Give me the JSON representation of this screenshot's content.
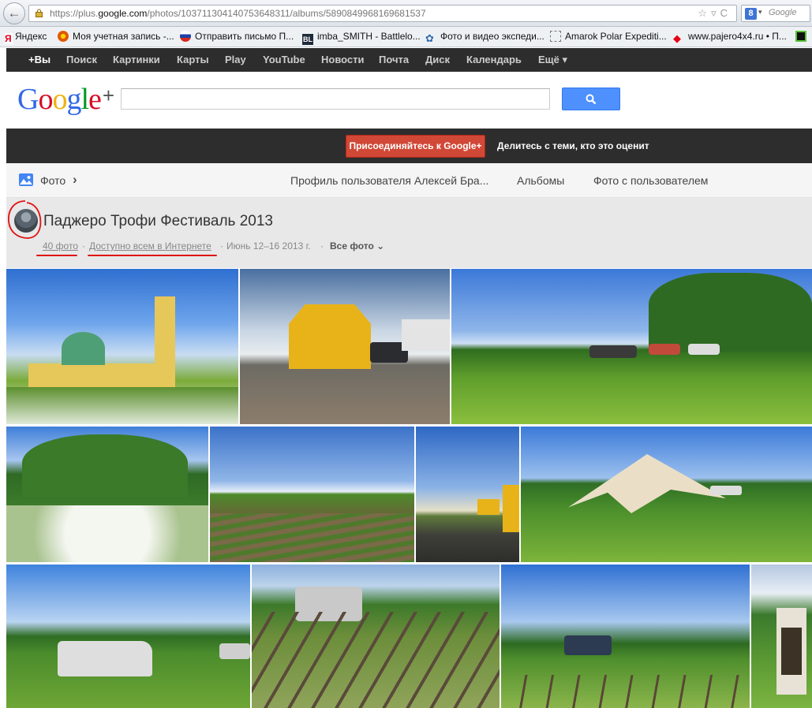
{
  "browser": {
    "url_prefix": "https://plus.",
    "url_domain": "google.com",
    "url_path": "/photos/103711304140753648311/albums/5890849968169681537",
    "search_placeholder": "Google"
  },
  "bookmarks": [
    {
      "label": "Яндекс",
      "color": "#e2001a"
    },
    {
      "label": "Моя учетная запись -...",
      "color": "#e05a00"
    },
    {
      "label": "Отправить письмо П...",
      "color": "#c8102e"
    },
    {
      "label": "imba_SMITH - Battlelo...",
      "color": "#1f2a3a"
    },
    {
      "label": "Фото и видео экспеди...",
      "color": "#2d6bb0"
    },
    {
      "label": "Amarok Polar Expediti...",
      "color": "#ffffff"
    },
    {
      "label": "www.pajero4x4.ru • П...",
      "color": "#e60012"
    }
  ],
  "gbar": [
    "+Вы",
    "Поиск",
    "Картинки",
    "Карты",
    "Play",
    "YouTube",
    "Новости",
    "Почта",
    "Диск",
    "Календарь",
    "Ещё ▾"
  ],
  "logo": {
    "text": "Google",
    "plus": "+"
  },
  "join": {
    "button": "Присоединяйтесь к Google+",
    "text": "Делитесь с теми, кто это оценит"
  },
  "section": {
    "title": "Фото",
    "tabs": [
      "Профиль пользователя Алексей Бра...",
      "Альбомы",
      "Фото с пользователем"
    ]
  },
  "album": {
    "title": "Паджеро Трофи Фестиваль 2013",
    "count": "40 фото",
    "visibility": "Доступно всем в Интернете",
    "date": "Июнь 12–16 2013 г.",
    "all_photos": "Все фото"
  }
}
